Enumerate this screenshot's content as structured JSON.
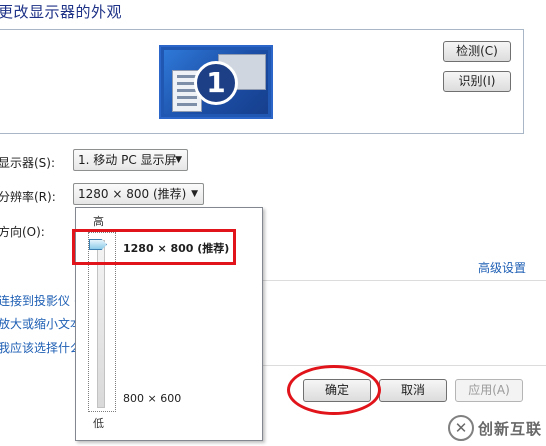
{
  "page": {
    "title": "更改显示器的外观"
  },
  "preview": {
    "monitor_number": "1",
    "detect_label": "检测(C)",
    "identify_label": "识别(I)"
  },
  "settings": {
    "display_label": "显示器(S):",
    "display_value": "1. 移动 PC 显示屏",
    "resolution_label": "分辨率(R):",
    "resolution_value": "1280 × 800 (推荐)",
    "orientation_label": "方向(O):"
  },
  "resolution_popup": {
    "high_label": "高",
    "low_label": "低",
    "options": [
      "1280 × 800 (推荐)",
      "800 × 600"
    ],
    "selected_fraction": 1.0
  },
  "links": {
    "advanced": "高级设置",
    "projector": "连接到投影仪 (",
    "text_size": "放大或缩小文本",
    "choose": "我应该选择什么"
  },
  "footer": {
    "ok_label": "确定",
    "cancel_label": "取消",
    "apply_label": "应用(A)"
  },
  "watermark": {
    "logo_glyph": "✕",
    "text": "创新互联"
  },
  "colors": {
    "link": "#1e5fb4",
    "title": "#1e3287",
    "highlight": "#e0141a"
  }
}
